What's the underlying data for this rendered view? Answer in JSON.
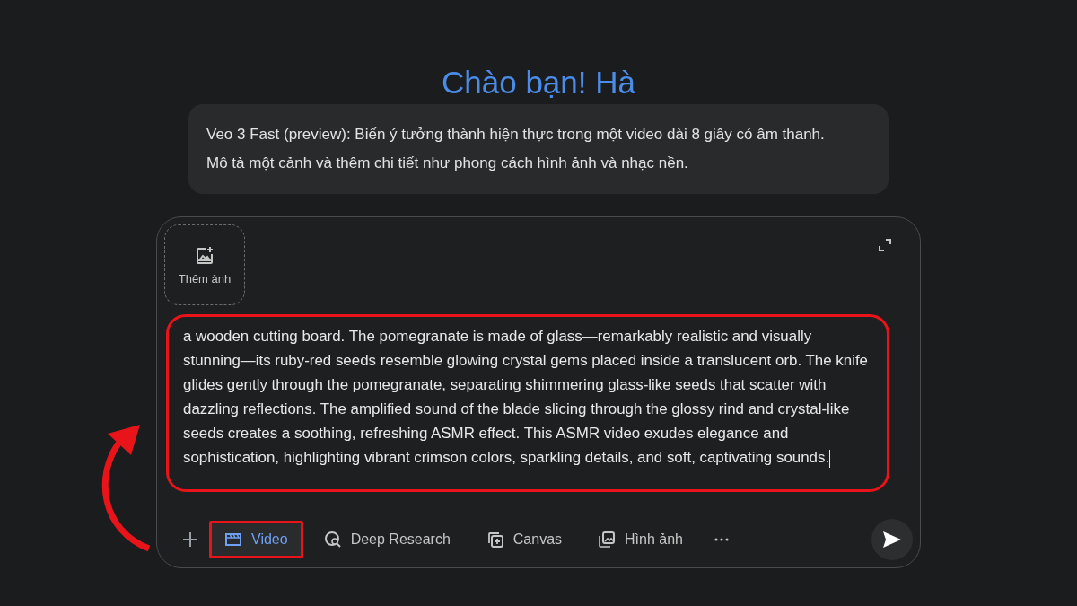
{
  "greeting": "Chào bạn! Hà",
  "info_card": {
    "lines": [
      "Veo 3 Fast (preview): Biến ý tưởng thành hiện thực trong một video dài 8 giây có âm thanh.",
      "Mô tả một cảnh và thêm chi tiết như phong cách hình ảnh và nhạc nền."
    ]
  },
  "composer": {
    "add_image": {
      "label": "Thêm ảnh"
    },
    "prompt": {
      "value": "a wooden cutting board. The pomegranate is made of glass—remarkably realistic and visually stunning—its ruby-red seeds resemble glowing crystal gems placed inside a translucent orb. The knife glides gently through the pomegranate, separating shimmering glass-like seeds that scatter with dazzling reflections. The amplified sound of the blade slicing through the glossy rind and crystal-like seeds creates a soothing, refreshing ASMR effect. This ASMR video exudes elegance and sophistication, highlighting vibrant crimson colors, sparkling details, and soft, captivating sounds.",
      "highlighted": true
    },
    "tools": [
      {
        "kind": "video",
        "label": "Video",
        "selected": true,
        "highlighted": true
      },
      {
        "kind": "research",
        "label": "Deep Research",
        "selected": false,
        "highlighted": false
      },
      {
        "kind": "canvas",
        "label": "Canvas",
        "selected": false,
        "highlighted": false
      },
      {
        "kind": "image",
        "label": "Hình ảnh",
        "selected": false,
        "highlighted": false
      }
    ]
  }
}
